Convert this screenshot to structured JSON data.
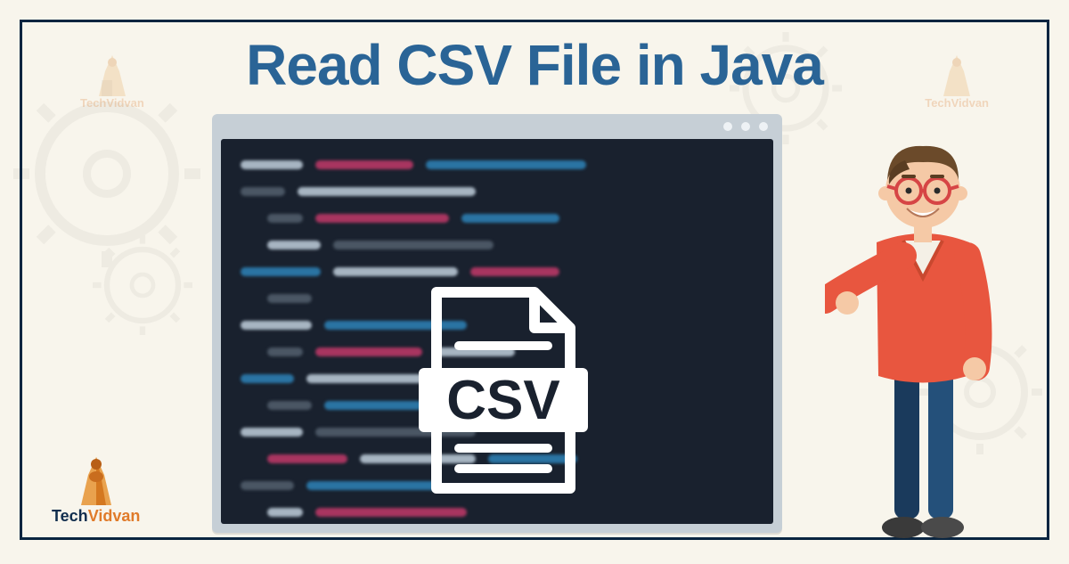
{
  "title": "Read CSV File in Java",
  "csv_label": "CSV",
  "brand": {
    "part1": "Tech",
    "part2": "Vidvan"
  },
  "colors": {
    "title": "#2a6496",
    "frame": "#0a2540",
    "bg": "#f8f5ec",
    "brand_dark": "#112e4e",
    "brand_orange": "#e07b2a"
  },
  "editor": {
    "dots": 3
  }
}
